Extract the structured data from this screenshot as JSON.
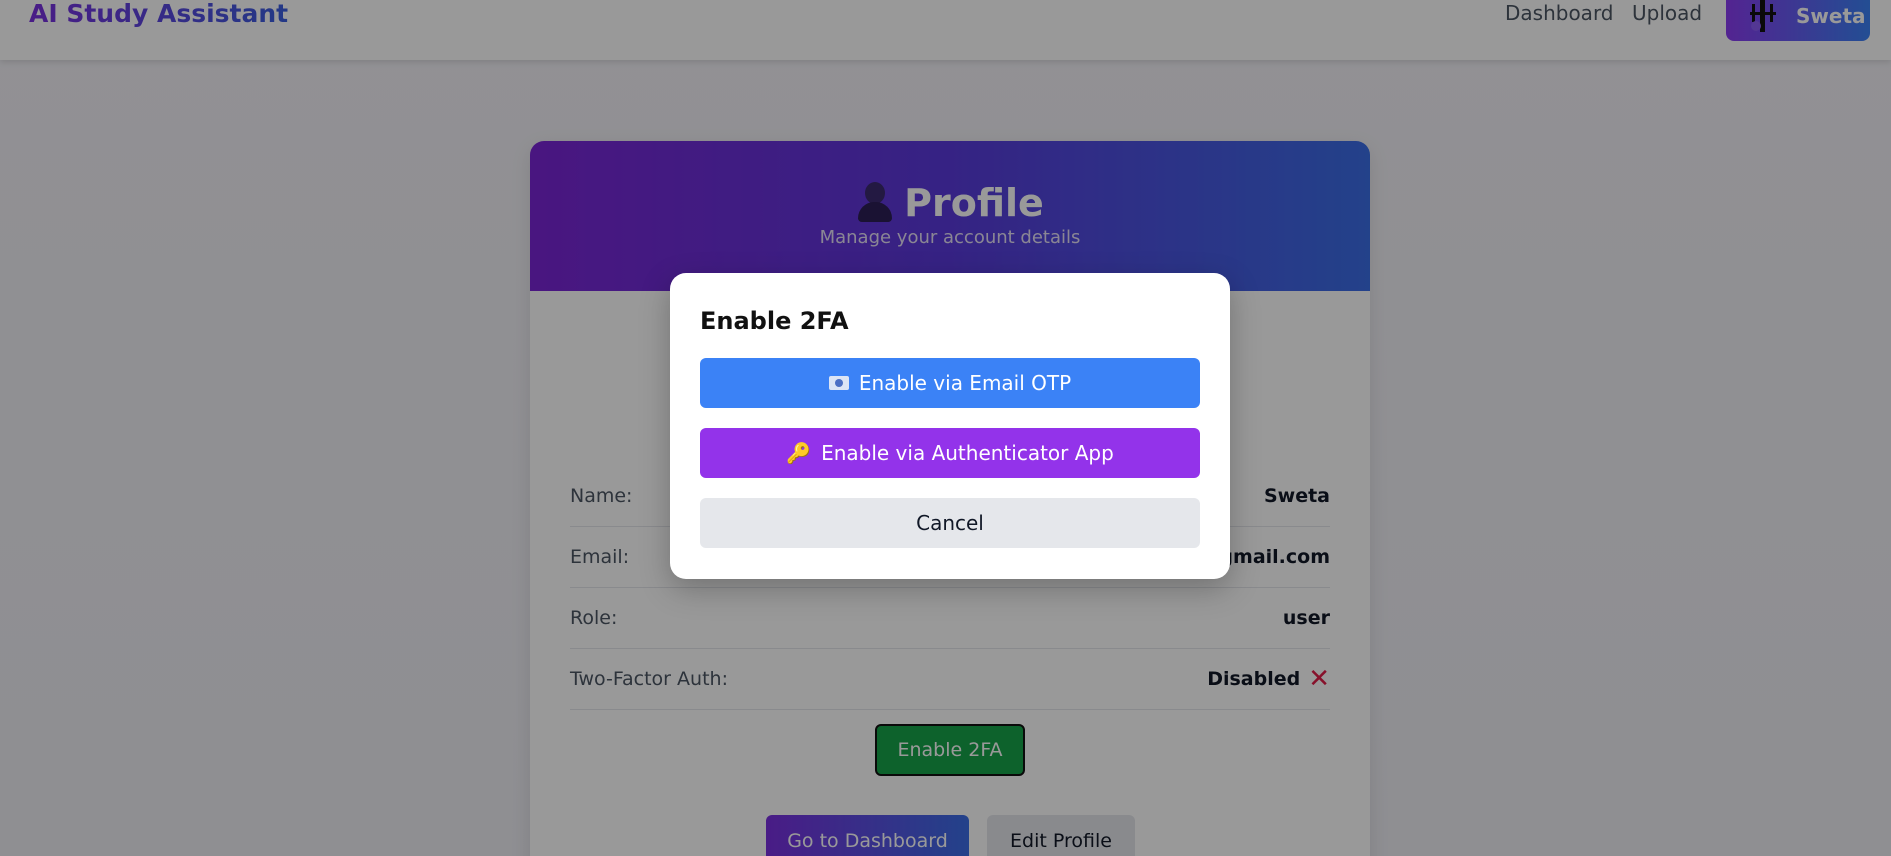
{
  "navbar": {
    "brand": "AI Study Assistant",
    "links": [
      "Dashboard",
      "Upload"
    ],
    "user_name": "Sweta"
  },
  "profile": {
    "title": "Profile",
    "subtitle": "Manage your account details",
    "fields": [
      {
        "label": "Name:",
        "value": "Sweta"
      },
      {
        "label": "Email:",
        "value": "@gmail.com"
      },
      {
        "label": "Role:",
        "value": "user"
      },
      {
        "label": "Two-Factor Auth:",
        "value": "Disabled"
      }
    ],
    "enable_2fa_button": "Enable 2FA",
    "go_dashboard_button": "Go to Dashboard",
    "edit_profile_button": "Edit Profile"
  },
  "modal": {
    "title": "Enable 2FA",
    "email_otp_button": "Enable via Email OTP",
    "authenticator_button": "Enable via Authenticator App",
    "cancel_button": "Cancel"
  },
  "icons": {
    "twofa_status_icon": "x-icon",
    "email_button_icon": "email-icon",
    "auth_button_icon": "key-icon"
  },
  "colors": {
    "brand_gradient_start": "#7b2fe0",
    "brand_gradient_end": "#3b6ee6",
    "email_button": "#3b82f6",
    "auth_button": "#9333ea",
    "enable_button": "#16a34a",
    "disabled_x": "#e11d48"
  }
}
